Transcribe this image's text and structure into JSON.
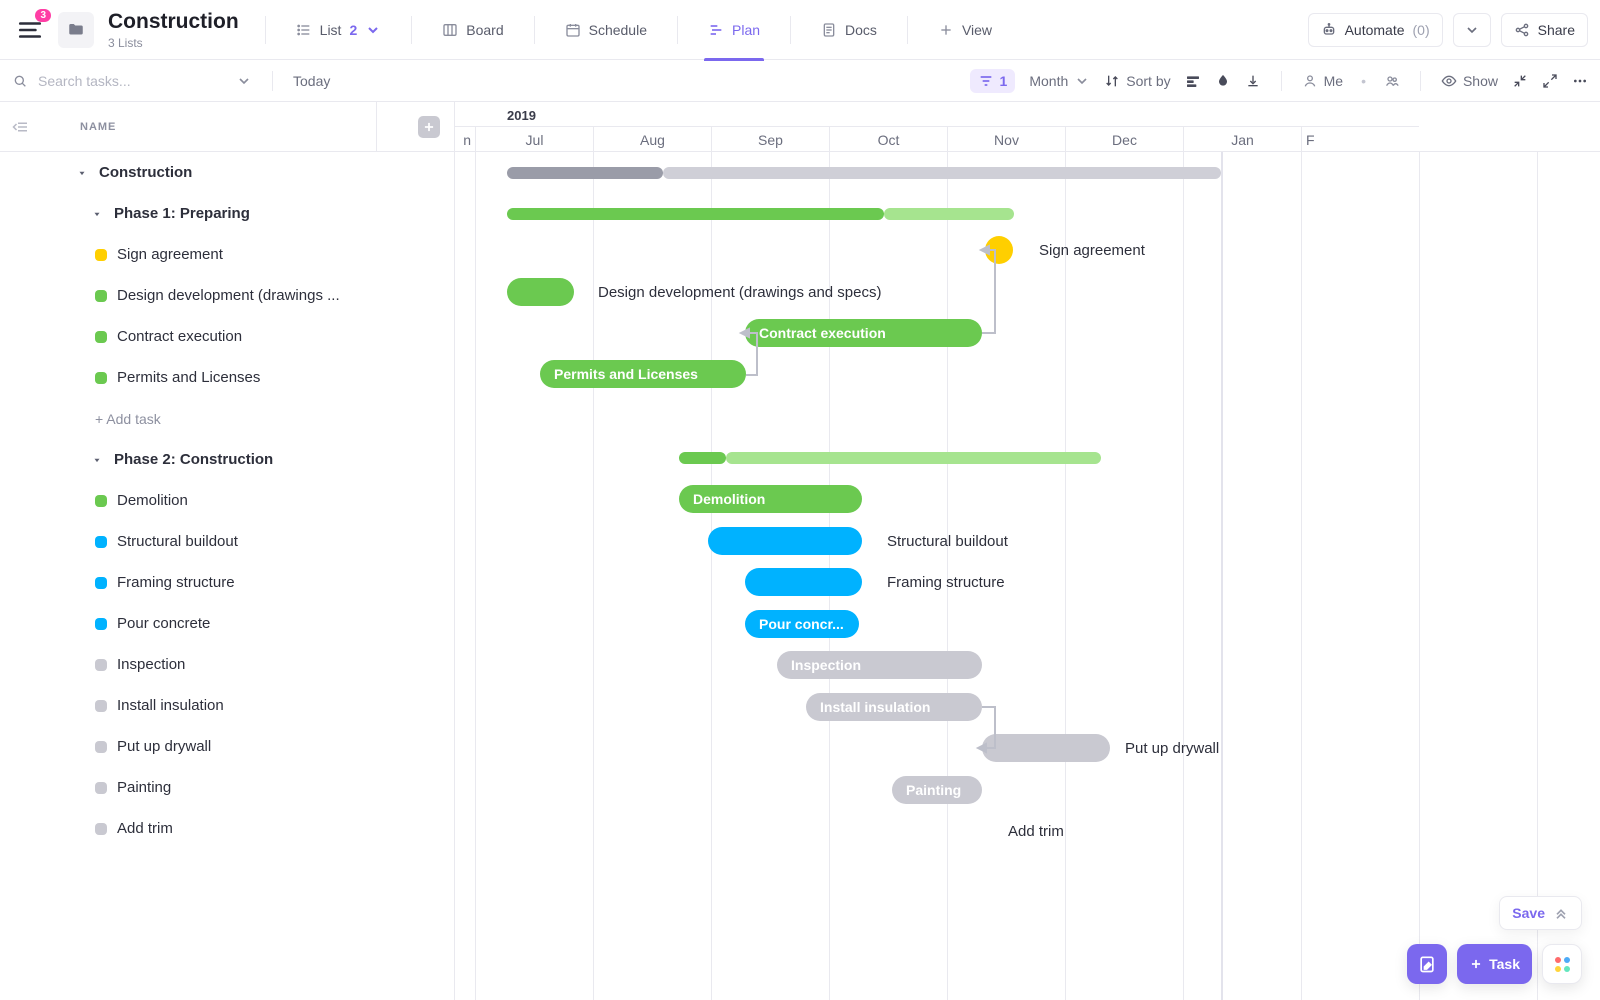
{
  "header": {
    "notifications": "3",
    "title": "Construction",
    "subtitle": "3 Lists",
    "views": {
      "list": {
        "label": "List",
        "count": "2"
      },
      "board": "Board",
      "schedule": "Schedule",
      "plan": "Plan",
      "docs": "Docs",
      "addview": "View"
    },
    "automate": {
      "prefix": "Automate",
      "count": "(0)"
    },
    "share": "Share"
  },
  "toolbar": {
    "searchPlaceholder": "Search tasks...",
    "today": "Today",
    "filterCount": "1",
    "zoom": "Month",
    "sortby": "Sort by",
    "me": "Me",
    "show": "Show"
  },
  "sidebar": {
    "nameHeader": "NAME",
    "groups": [
      {
        "type": "h1",
        "label": "Construction"
      },
      {
        "type": "h2",
        "label": "Phase 1: Preparing"
      },
      {
        "type": "task",
        "color": "#ffcf00",
        "label": "Sign agreement"
      },
      {
        "type": "task",
        "color": "#6bc950",
        "label": "Design development (drawings ..."
      },
      {
        "type": "task",
        "color": "#6bc950",
        "label": "Contract execution"
      },
      {
        "type": "task",
        "color": "#6bc950",
        "label": "Permits and Licenses"
      },
      {
        "type": "addtask",
        "label": "+ Add task"
      },
      {
        "type": "h2",
        "label": "Phase 2: Construction"
      },
      {
        "type": "task",
        "color": "#6bc950",
        "label": "Demolition"
      },
      {
        "type": "task",
        "color": "#00b2ff",
        "label": "Structural buildout"
      },
      {
        "type": "task",
        "color": "#00b2ff",
        "label": "Framing structure"
      },
      {
        "type": "task",
        "color": "#00b2ff",
        "label": "Pour concrete"
      },
      {
        "type": "task",
        "color": "#c9c9d1",
        "label": "Inspection"
      },
      {
        "type": "task",
        "color": "#c9c9d1",
        "label": "Install insulation"
      },
      {
        "type": "task",
        "color": "#c9c9d1",
        "label": "Put up drywall"
      },
      {
        "type": "task",
        "color": "#c9c9d1",
        "label": "Painting"
      },
      {
        "type": "task",
        "color": "#c9c9d1",
        "label": "Add trim"
      }
    ]
  },
  "gantt": {
    "year": "2019",
    "prevMonthFragment": "n",
    "months": [
      "Jul",
      "Aug",
      "Sep",
      "Oct",
      "Nov",
      "Dec",
      "Jan"
    ],
    "nextMonthFragment": "F",
    "bars": {
      "grandSummaryDone": "Construction completed range",
      "grandSummaryTodo": "Construction remaining range",
      "phase1Done": "Phase 1 completed range",
      "phase1Todo": "Phase 1 remaining range",
      "signAgreement": "Sign agreement",
      "designDev": "Design development (drawings and specs)",
      "contractExec": "Contract execution",
      "permits": "Permits and Licenses",
      "phase2Done": "Phase 2 completed range",
      "phase2Todo": "Phase 2 remaining range",
      "demolition": "Demolition",
      "structural": "Structural buildout",
      "framing": "Framing structure",
      "pourConcrete": "Pour concr...",
      "inspection": "Inspection",
      "insulation": "Install insulation",
      "drywall": "Put up drywall",
      "painting": "Painting",
      "addTrim": "Add trim"
    }
  },
  "float": {
    "save": "Save",
    "task": "Task"
  },
  "chart_data": {
    "type": "gantt",
    "time_axis": {
      "unit": "month",
      "start": "2019-06",
      "end": "2020-02"
    },
    "tasks": [
      {
        "name": "Construction",
        "kind": "summary",
        "start": "2019-07-01",
        "end": "2019-12-31",
        "progress": 0.22
      },
      {
        "name": "Phase 1: Preparing",
        "kind": "summary",
        "start": "2019-07-01",
        "end": "2019-11-10",
        "progress": 0.74
      },
      {
        "name": "Sign agreement",
        "kind": "milestone",
        "date": "2019-11-10",
        "status": "pending",
        "color": "#ffcf00"
      },
      {
        "name": "Design development (drawings and specs)",
        "kind": "task",
        "start": "2019-07-01",
        "end": "2019-07-20",
        "status": "done",
        "color": "#6bc950"
      },
      {
        "name": "Contract execution",
        "kind": "task",
        "start": "2019-09-01",
        "end": "2019-11-01",
        "status": "done",
        "color": "#6bc950",
        "depends_on": [
          "Permits and Licenses"
        ]
      },
      {
        "name": "Permits and Licenses",
        "kind": "task",
        "start": "2019-07-10",
        "end": "2019-08-28",
        "status": "done",
        "color": "#6bc950"
      },
      {
        "name": "Phase 2: Construction",
        "kind": "summary",
        "start": "2019-08-15",
        "end": "2019-12-10",
        "progress": 0.12
      },
      {
        "name": "Demolition",
        "kind": "task",
        "start": "2019-08-15",
        "end": "2019-10-01",
        "status": "done",
        "color": "#6bc950"
      },
      {
        "name": "Structural buildout",
        "kind": "task",
        "start": "2019-08-28",
        "end": "2019-10-05",
        "status": "in-progress",
        "color": "#00b2ff"
      },
      {
        "name": "Framing structure",
        "kind": "task",
        "start": "2019-09-05",
        "end": "2019-10-05",
        "status": "in-progress",
        "color": "#00b2ff"
      },
      {
        "name": "Pour concrete",
        "kind": "task",
        "start": "2019-09-05",
        "end": "2019-10-05",
        "status": "in-progress",
        "color": "#00b2ff"
      },
      {
        "name": "Inspection",
        "kind": "task",
        "start": "2019-09-15",
        "end": "2019-11-05",
        "status": "todo",
        "color": "#c9c9d1"
      },
      {
        "name": "Install insulation",
        "kind": "task",
        "start": "2019-09-25",
        "end": "2019-11-05",
        "status": "todo",
        "color": "#c9c9d1",
        "depends_on": []
      },
      {
        "name": "Put up drywall",
        "kind": "task",
        "start": "2019-11-05",
        "end": "2019-12-10",
        "status": "todo",
        "color": "#c9c9d1",
        "depends_on": [
          "Install insulation"
        ]
      },
      {
        "name": "Painting",
        "kind": "task",
        "start": "2019-10-15",
        "end": "2019-11-05",
        "status": "todo",
        "color": "#c9c9d1"
      },
      {
        "name": "Add trim",
        "kind": "task",
        "start": "2019-11-10",
        "end": "2019-11-10",
        "status": "todo",
        "color": "#c9c9d1"
      }
    ]
  }
}
